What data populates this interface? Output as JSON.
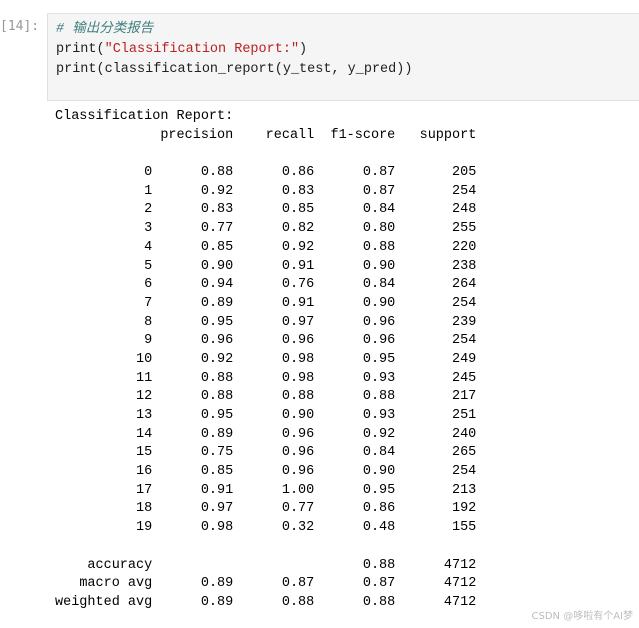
{
  "cell": {
    "prompt": "[14]:",
    "comment": "# 输出分类报告",
    "line2_prefix": "print(",
    "line2_string": "\"Classification Report:\"",
    "line2_suffix": ")",
    "line3": "print(classification_report(y_test, y_pred))"
  },
  "report": {
    "title": "Classification Report:",
    "headers": [
      "precision",
      "recall",
      "f1-score",
      "support"
    ],
    "rows": [
      {
        "label": "0",
        "precision": "0.88",
        "recall": "0.86",
        "f1": "0.87",
        "support": "205"
      },
      {
        "label": "1",
        "precision": "0.92",
        "recall": "0.83",
        "f1": "0.87",
        "support": "254"
      },
      {
        "label": "2",
        "precision": "0.83",
        "recall": "0.85",
        "f1": "0.84",
        "support": "248"
      },
      {
        "label": "3",
        "precision": "0.77",
        "recall": "0.82",
        "f1": "0.80",
        "support": "255"
      },
      {
        "label": "4",
        "precision": "0.85",
        "recall": "0.92",
        "f1": "0.88",
        "support": "220"
      },
      {
        "label": "5",
        "precision": "0.90",
        "recall": "0.91",
        "f1": "0.90",
        "support": "238"
      },
      {
        "label": "6",
        "precision": "0.94",
        "recall": "0.76",
        "f1": "0.84",
        "support": "264"
      },
      {
        "label": "7",
        "precision": "0.89",
        "recall": "0.91",
        "f1": "0.90",
        "support": "254"
      },
      {
        "label": "8",
        "precision": "0.95",
        "recall": "0.97",
        "f1": "0.96",
        "support": "239"
      },
      {
        "label": "9",
        "precision": "0.96",
        "recall": "0.96",
        "f1": "0.96",
        "support": "254"
      },
      {
        "label": "10",
        "precision": "0.92",
        "recall": "0.98",
        "f1": "0.95",
        "support": "249"
      },
      {
        "label": "11",
        "precision": "0.88",
        "recall": "0.98",
        "f1": "0.93",
        "support": "245"
      },
      {
        "label": "12",
        "precision": "0.88",
        "recall": "0.88",
        "f1": "0.88",
        "support": "217"
      },
      {
        "label": "13",
        "precision": "0.95",
        "recall": "0.90",
        "f1": "0.93",
        "support": "251"
      },
      {
        "label": "14",
        "precision": "0.89",
        "recall": "0.96",
        "f1": "0.92",
        "support": "240"
      },
      {
        "label": "15",
        "precision": "0.75",
        "recall": "0.96",
        "f1": "0.84",
        "support": "265"
      },
      {
        "label": "16",
        "precision": "0.85",
        "recall": "0.96",
        "f1": "0.90",
        "support": "254"
      },
      {
        "label": "17",
        "precision": "0.91",
        "recall": "1.00",
        "f1": "0.95",
        "support": "213"
      },
      {
        "label": "18",
        "precision": "0.97",
        "recall": "0.77",
        "f1": "0.86",
        "support": "192"
      },
      {
        "label": "19",
        "precision": "0.98",
        "recall": "0.32",
        "f1": "0.48",
        "support": "155"
      }
    ],
    "summary": [
      {
        "label": "accuracy",
        "precision": "",
        "recall": "",
        "f1": "0.88",
        "support": "4712"
      },
      {
        "label": "macro avg",
        "precision": "0.89",
        "recall": "0.87",
        "f1": "0.87",
        "support": "4712"
      },
      {
        "label": "weighted avg",
        "precision": "0.89",
        "recall": "0.88",
        "f1": "0.88",
        "support": "4712"
      }
    ]
  },
  "watermark": "CSDN @哆啦有个AI梦"
}
